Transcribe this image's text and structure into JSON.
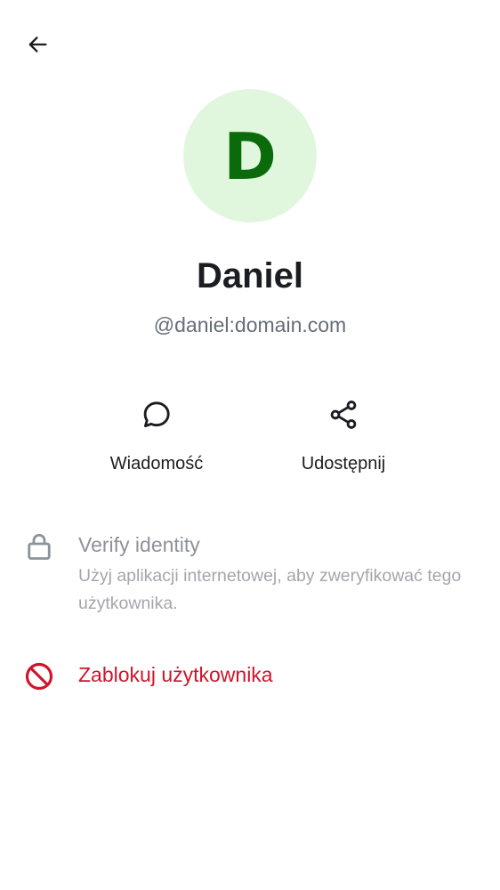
{
  "header": {
    "back_icon": "arrow-left-icon"
  },
  "profile": {
    "avatar_initial": "D",
    "avatar_bg": "#e0f7de",
    "avatar_fg": "#0b6b0b",
    "display_name": "Daniel",
    "user_id": "@daniel:domain.com"
  },
  "actions": [
    {
      "icon": "chat-bubble-icon",
      "label": "Wiadomość"
    },
    {
      "icon": "share-icon",
      "label": "Udostępnij"
    }
  ],
  "verify": {
    "icon": "lock-icon",
    "title": "Verify identity",
    "description": "Użyj aplikacji internetowej, aby zweryfikować tego użytkownika."
  },
  "block": {
    "icon": "block-icon",
    "label": "Zablokuj użytkownika",
    "color": "#d0142b"
  }
}
